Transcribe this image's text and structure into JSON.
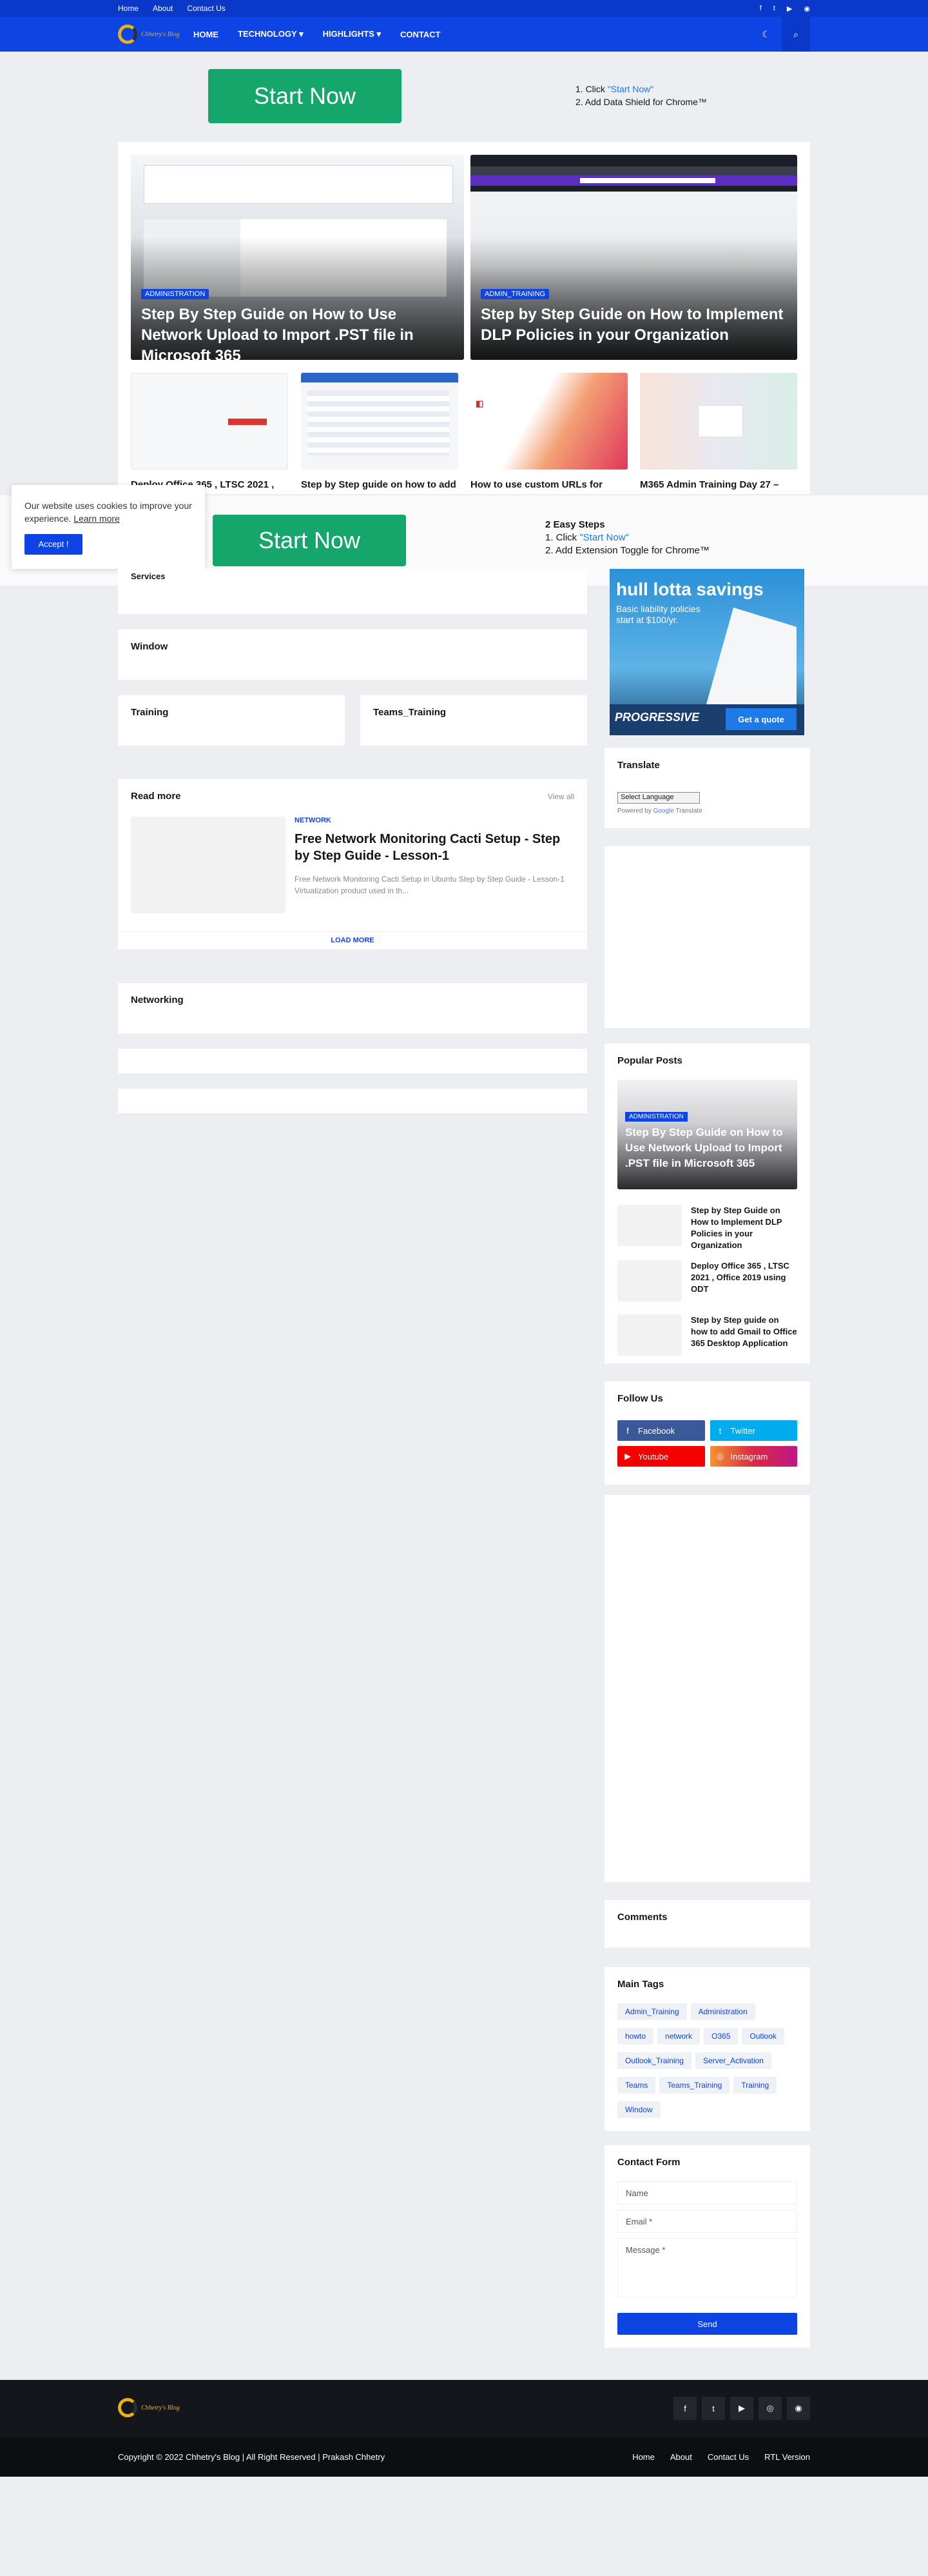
{
  "topbar": {
    "links": [
      "Home",
      "About",
      "Contact Us"
    ],
    "social_icons": [
      "facebook-icon",
      "twitter-icon",
      "youtube-icon",
      "rss-icon"
    ]
  },
  "nav": {
    "logo_text": "Chhetry's Blog",
    "items": [
      "HOME",
      "TECHNOLOGY",
      "HIGHLIGHTS",
      "CONTACT"
    ],
    "dropdown_icon": "chevron-down-icon"
  },
  "ad_top": {
    "button": "Start Now",
    "step1_prefix": "1. Click ",
    "step1_link": "\"Start Now\"",
    "step2": "2. Add Data Shield for Chrome™"
  },
  "featured": [
    {
      "category": "ADMINISTRATION",
      "title": "Step By Step Guide on How to Use Network Upload to Import .PST file in Microsoft 365"
    },
    {
      "category": "ADMIN_TRAINING",
      "title": "Step by Step Guide on How to Implement DLP Policies in your Organization"
    }
  ],
  "small_posts": [
    {
      "title": "Deploy Office 365 , LTSC 2021 , Office 2019 using ODT"
    },
    {
      "title": "Step by Step guide on how to add Gmail to Office 365 Desktop Application"
    },
    {
      "title": "How to use custom URLs for Microsoft 365"
    },
    {
      "title": "M365 Admin Training Day 27 – Microsoft Teams Fundamentals"
    }
  ],
  "ad_middle": {
    "button": "Start Now",
    "heading": "2 Easy Steps",
    "step1_prefix": "1. Click ",
    "step1_link": "\"Start Now\"",
    "step2": "2. Add Extension Toggle for Chrome™"
  },
  "cookie": {
    "text": "Our website uses cookies to improve your experience.",
    "learn_more": "Learn more",
    "accept": "Accept !"
  },
  "sections": {
    "partial": "Services",
    "window": "Window",
    "training": "Training",
    "teams_training": "Teams_Training",
    "networking": "Networking"
  },
  "read_more": {
    "title": "Read more",
    "view_all": "View all",
    "post": {
      "category": "NETWORK",
      "title": "Free Network Monitoring Cacti Setup - Step by Step Guide - Lesson-1",
      "snippet": "Free Network Monitoring Cacti Setup in Ubuntu Step by Step Guide - Lesson-1 Virtualization product used in th..."
    },
    "load_more": "LOAD MORE"
  },
  "sidebar_ad": {
    "headline": "hull lotta savings",
    "line1": "Basic liability policies",
    "line2": "start at $100/yr.",
    "brand": "PROGRESSIVE",
    "cta": "Get a quote"
  },
  "translate": {
    "title": "Translate",
    "select": "Select Language",
    "powered_by": "Powered by",
    "google": "Google",
    "translate_word": "Translate"
  },
  "popular": {
    "title": "Popular Posts",
    "top": {
      "category": "ADMINISTRATION",
      "title": "Step By Step Guide on How to Use Network Upload to Import .PST file in Microsoft 365"
    },
    "items": [
      "Step by Step Guide on How to Implement DLP Policies in your Organization",
      "Deploy Office 365 , LTSC 2021 , Office 2019 using ODT",
      "Step by Step guide on how to add Gmail to Office 365 Desktop Application"
    ]
  },
  "follow": {
    "title": "Follow Us",
    "buttons": [
      {
        "label": "Facebook",
        "icon": "facebook-icon",
        "color": "#3b5999"
      },
      {
        "label": "Twitter",
        "icon": "twitter-icon",
        "color": "#00acee"
      },
      {
        "label": "Youtube",
        "icon": "youtube-icon",
        "color": "#f50000"
      },
      {
        "label": "Instagram",
        "icon": "instagram-icon",
        "color": "#c13584"
      }
    ]
  },
  "comments": {
    "title": "Comments"
  },
  "tags": {
    "title": "Main Tags",
    "items": [
      "Admin_Training",
      "Administration",
      "howto",
      "network",
      "O365",
      "Outlook",
      "Outlook_Training",
      "Server_Activation",
      "Teams",
      "Teams_Training",
      "Training",
      "Window"
    ]
  },
  "contact": {
    "title": "Contact Form",
    "name": "Name",
    "email": "Email *",
    "message": "Message *",
    "send": "Send"
  },
  "footer": {
    "copyright": "Copyright © 2022 Chhetry's Blog | All Right Reserved | Prakash Chhetry",
    "links": [
      "Home",
      "About",
      "Contact Us",
      "RTL Version"
    ]
  },
  "colors": {
    "brand": "#0d44e3",
    "cta_green": "#14a66a",
    "footer": "#15161c"
  }
}
